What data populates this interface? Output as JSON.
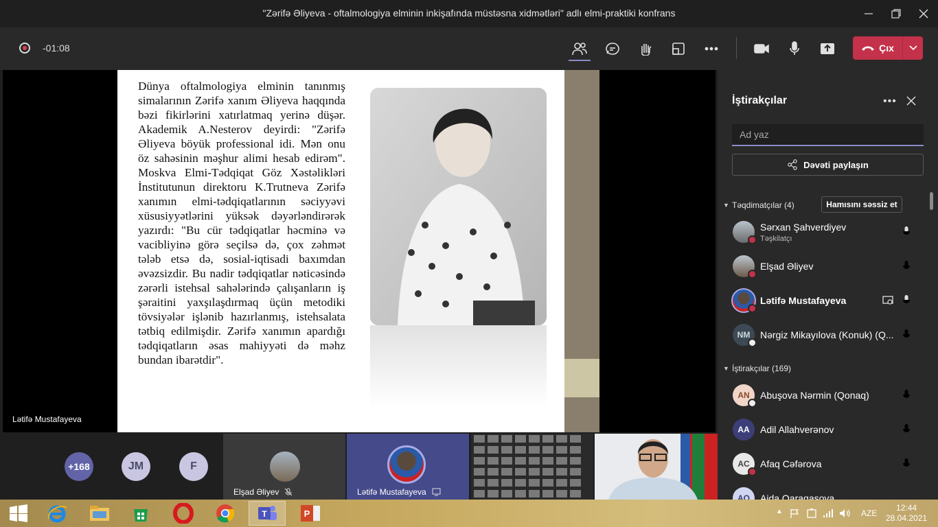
{
  "window": {
    "title": "\"Zərifə Əliyeva - oftalmologiya elminin inkişafında müstəsna xidmətləri\" adlı elmi-praktiki konfrans"
  },
  "meeting": {
    "timer": "-01:08",
    "leave_label": "Çıx"
  },
  "stage": {
    "presenter_name": "Lətifə Mustafayeva",
    "slide_text": "Dünya oftalmologiya elminin tanınmış simalarının Zərifə xanım Əliyeva haqqında bəzi fikirlərini xatırlatmaq yerinə düşər. Akademik A.Nesterov deyirdi: \"Zərifə Əliyeva böyük professional idi. Mən onu öz sahəsinin məşhur alimi hesab edirəm\". Moskva Elmi-Tədqiqat Göz Xəstəlikləri İnstitutunun direktoru K.Trutneva Zərifə xanımın elmi-tədqiqatlarının səciyyəvi xüsusiyyətlərini yüksək dəyərləndirərək yazırdı: \"Bu cür tədqiqatlar həcminə və vacibliyinə görə seçilsə də, çox zəhmət tələb etsə də, sosial-iqtisadi baxımdan əvəzsizdir. Bu nadir tədqiqatlar nəticəsində zərərli istehsal sahələrində çalışanların iş şəraitini yaxşılaşdırmaq üçün metodiki tövsiyələr işlənib hazırlanmış, istehsalata tətbiq edilmişdir. Zərifə xanımın apardığı tədqiqatların əsas mahiyyəti də məhz bundan ibarətdir\"."
  },
  "strip": {
    "overflow_count": "+168",
    "initials_1": "JM",
    "initials_2": "F",
    "tile_1_name": "Elşad Əliyev",
    "tile_2_name": "Lətifə Mustafayeva"
  },
  "panel": {
    "title": "İştirakçılar",
    "search_placeholder": "Ad yaz",
    "invite_label": "Dəvəti paylaşın",
    "presenters_header": "Təqdimatçılar (4)",
    "mute_all_label": "Hamısını səssiz et",
    "attendees_header": "İştirakçılar (169)",
    "presenters": [
      {
        "name": "Sərxan Şahverdiyev",
        "role": "Təşkilatçı",
        "initials": "",
        "avatar_color": "#6b6b6b"
      },
      {
        "name": "Elşad Əliyev",
        "role": "",
        "initials": "",
        "avatar_color": "#6b5a4a"
      },
      {
        "name": "Lətifə Mustafayeva",
        "role": "",
        "initials": "",
        "avatar_color": "#5a5fa8"
      },
      {
        "name": "Nərgiz Mikayılova (Konuk) (Q...",
        "role": "",
        "initials": "NM",
        "avatar_color": "#3d4a55"
      }
    ],
    "attendees": [
      {
        "name": "Abuşova Nərmin (Qonaq)",
        "initials": "AN",
        "avatar_color": "#f0d5c8",
        "initials_color": "#8a4a2a"
      },
      {
        "name": "Adil Allahverənov",
        "initials": "AA",
        "avatar_color": "#3c3f77",
        "initials_color": "#ffffff"
      },
      {
        "name": "Afaq Cəfərova",
        "initials": "AC",
        "avatar_color": "#e8e8e8",
        "initials_color": "#444444"
      },
      {
        "name": "Aida Qaraqaşova",
        "initials": "AQ",
        "avatar_color": "#d0d6f0",
        "initials_color": "#3c3f77"
      }
    ]
  },
  "taskbar": {
    "language": "AZE",
    "time": "12:44",
    "date": "28.04.2021"
  }
}
